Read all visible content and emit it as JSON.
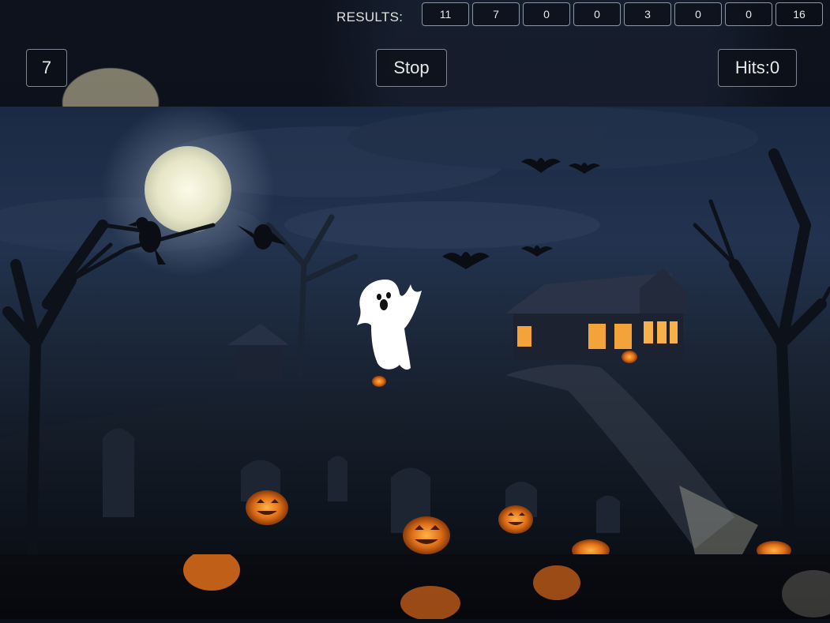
{
  "header": {
    "results_label": "RESULTS:",
    "results": [
      "11",
      "7",
      "0",
      "0",
      "3",
      "0",
      "0",
      "16"
    ]
  },
  "controls": {
    "level": "7",
    "stop_label": "Stop",
    "hits_label": "Hits:0"
  },
  "colors": {
    "accent_border": "#8d96a4",
    "pumpkin": "#f08a1c",
    "moon": "#f4f1d8",
    "ghost": "#ffffff"
  },
  "scene": {
    "target": "ghost-icon",
    "decor_icons": [
      "moon-icon",
      "crow-icon",
      "bat-icon",
      "haunted-house-icon",
      "pumpkin-icon",
      "tombstone-icon",
      "dead-tree-icon"
    ]
  }
}
